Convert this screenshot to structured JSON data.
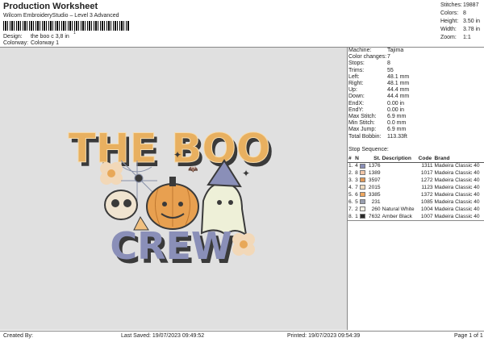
{
  "header": {
    "title": "Production Worksheet",
    "subtitle": "Wilcom EmbroideryStudio – Level 3 Advanced",
    "barcode_mark": "1",
    "design_label": "Design:",
    "design_value": "the boo c 3,8 in",
    "colorway_label": "Colorway:",
    "colorway_value": "Colorway 1"
  },
  "stats": [
    {
      "label": "Stitches:",
      "value": "19887"
    },
    {
      "label": "Colors:",
      "value": "8"
    },
    {
      "label": "Height:",
      "value": "3.50 in"
    },
    {
      "label": "Width:",
      "value": "3.78 in"
    },
    {
      "label": "Zoom:",
      "value": "1:1"
    }
  ],
  "artwork": {
    "line1": "THE BOO",
    "line2": "CREW"
  },
  "machine_info": [
    {
      "label": "Machine:",
      "value": "Tajima"
    },
    {
      "label": "Color changes:",
      "value": "7"
    },
    {
      "label": "Stops:",
      "value": "8"
    },
    {
      "label": "Trims:",
      "value": "55"
    },
    {
      "label": "Left:",
      "value": "48.1 mm"
    },
    {
      "label": "Right:",
      "value": "48.1 mm"
    },
    {
      "label": "Up:",
      "value": "44.4 mm"
    },
    {
      "label": "Down:",
      "value": "44.4 mm"
    },
    {
      "label": "EndX:",
      "value": "0.00 in"
    },
    {
      "label": "EndY:",
      "value": "0.00 in"
    },
    {
      "label": "Max Stitch:",
      "value": "6.9 mm"
    },
    {
      "label": "Min Stitch:",
      "value": "0.0 mm"
    },
    {
      "label": "Max Jump:",
      "value": "6.9 mm"
    },
    {
      "label": "Total Bobbin:",
      "value": "113.33ft"
    }
  ],
  "stop_sequence": {
    "title": "Stop Sequence:",
    "columns": [
      "#",
      "N",
      "St.",
      "Description",
      "Code",
      "Brand"
    ],
    "rows": [
      {
        "n": "1.",
        "needle": "4",
        "color": "#8a8fb8",
        "st": "1376",
        "desc": "",
        "code": "1311",
        "brand": "Madeira Classic 40"
      },
      {
        "n": "2.",
        "needle": "8",
        "color": "#f2c6a8",
        "st": "1389",
        "desc": "",
        "code": "1017",
        "brand": "Madeira Classic 40"
      },
      {
        "n": "3.",
        "needle": "3",
        "color": "#e09a5a",
        "st": "3597",
        "desc": "",
        "code": "1272",
        "brand": "Madeira Classic 40"
      },
      {
        "n": "4.",
        "needle": "7",
        "color": "#f0dcc0",
        "st": "2015",
        "desc": "",
        "code": "1123",
        "brand": "Madeira Classic 40"
      },
      {
        "n": "5.",
        "needle": "6",
        "color": "#f0a860",
        "st": "3385",
        "desc": "",
        "code": "1372",
        "brand": "Madeira Classic 40"
      },
      {
        "n": "6.",
        "needle": "5",
        "color": "#9aa0b0",
        "st": "231",
        "desc": "",
        "code": "1085",
        "brand": "Madeira Classic 40"
      },
      {
        "n": "7.",
        "needle": "2",
        "color": "#f4f0e4",
        "st": "260",
        "desc": "Natural White",
        "code": "1004",
        "brand": "Madeira Classic 40"
      },
      {
        "n": "8.",
        "needle": "1",
        "color": "#2a2a2a",
        "st": "7632",
        "desc": "Amber Black",
        "code": "1007",
        "brand": "Madeira Classic 40"
      }
    ]
  },
  "footer": {
    "created": "Created By:",
    "saved": "Last Saved: 19/07/2023 09:49:52",
    "printed": "Printed: 19/07/2023 09:54:39",
    "page": "Page 1 of 1"
  }
}
